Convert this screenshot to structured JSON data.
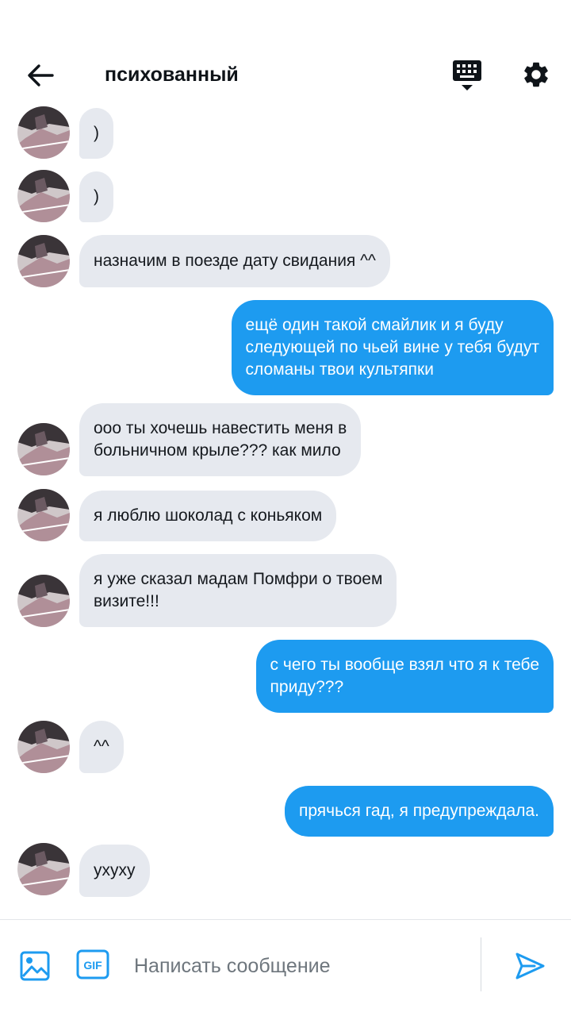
{
  "header": {
    "title": "психованный",
    "icons": [
      "back-arrow-icon",
      "keyboard-icon",
      "gear-icon"
    ]
  },
  "messages": [
    {
      "side": "in",
      "text": ")"
    },
    {
      "side": "in",
      "text": ")"
    },
    {
      "side": "in",
      "text": "назначим в поезде дату свидания ^^"
    },
    {
      "side": "out",
      "text": "ещё один такой смайлик и я буду\nследующей по чьей вине у тебя будут\nсломаны твои культяпки"
    },
    {
      "side": "in",
      "text": "ооо ты хочешь навестить меня в\nбольничном крыле??? как мило"
    },
    {
      "side": "in",
      "text": "я люблю шоколад с коньяком"
    },
    {
      "side": "in",
      "text": "я уже сказал мадам Помфри о твоем\nвизите!!!"
    },
    {
      "side": "out",
      "text": "с чего ты вообще взял что я к тебе\nприду???"
    },
    {
      "side": "in",
      "text": "^^"
    },
    {
      "side": "out",
      "text": "прячься гад, я предупреждала."
    },
    {
      "side": "in",
      "text": "ухуху"
    }
  ],
  "composer": {
    "placeholder": "Написать сообщение",
    "gif_label": "GIF",
    "icons": [
      "image-icon",
      "gif-icon",
      "send-icon"
    ]
  },
  "colors": {
    "accent": "#1d9bf0",
    "incoming_bubble": "#e6e9ef",
    "text": "#15191e"
  }
}
